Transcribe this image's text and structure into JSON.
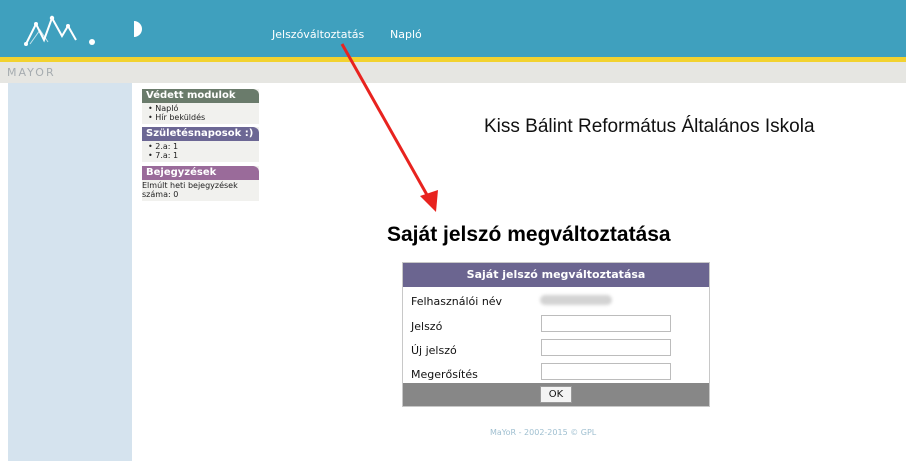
{
  "header": {
    "nav": [
      "Jelszóváltoztatás",
      "Napló"
    ],
    "brand": "MAYOR"
  },
  "sidebar_panels": [
    {
      "title": "Védett modulok",
      "color": "#6a7b6b",
      "items": [
        "Napló",
        "Hír beküldés"
      ]
    },
    {
      "title": "Születésnaposok :)",
      "color": "#6c6794",
      "items": [
        "2.a: 1",
        "7.a: 1"
      ]
    },
    {
      "title": "Bejegyzések",
      "color": "#9a6b9a",
      "text": "Elmúlt heti bejegyzések száma: 0"
    }
  ],
  "school_name": "Kiss Bálint Református Általános Iskola",
  "page_title": "Saját jelszó megváltoztatása",
  "form": {
    "title": "Saját jelszó megváltoztatása",
    "labels": {
      "username": "Felhasználói név",
      "password": "Jelszó",
      "new_password": "Új jelszó",
      "confirm": "Megerősítés"
    },
    "submit": "OK"
  },
  "footer": "MaYoR - 2002-2015 © GPL",
  "colors": {
    "header_bg": "#3fa0be",
    "accent_line": "#f2d22f",
    "form_header": "#6b6590",
    "arrow": "#e8231f"
  }
}
